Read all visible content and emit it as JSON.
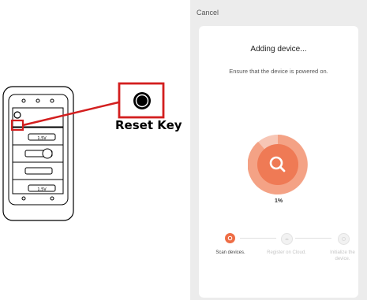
{
  "illustration": {
    "caption": "Reset Key",
    "keypad_labels": [
      "1.5V",
      "1.5V",
      "1.5V"
    ]
  },
  "app": {
    "cancel_label": "Cancel",
    "title": "Adding device...",
    "subtitle": "Ensure that the device is powered on.",
    "progress_text": "1%",
    "progress_value": 0.01,
    "accent_color": "#ee6d45",
    "steps": [
      {
        "label": "Scan devices.",
        "active": true
      },
      {
        "label": "Register on Cloud.",
        "active": false
      },
      {
        "label": "Initialize the device.",
        "active": false
      }
    ]
  }
}
